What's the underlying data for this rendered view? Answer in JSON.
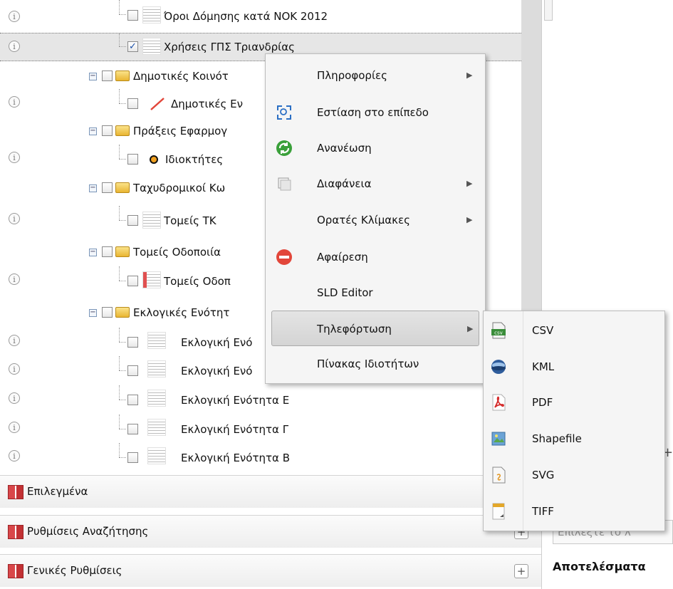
{
  "tree": {
    "info_glyph": "i",
    "rows": [
      {
        "label": "Όροι Δόμησης κατά ΝΟΚ 2012",
        "checked": false
      },
      {
        "label": "Χρήσεις ΓΠΣ Τριανδρίας",
        "checked": true
      },
      {
        "label": "Δημοτικές Κοινότ",
        "checked": false
      },
      {
        "label": "Δημοτικές Εν",
        "checked": false
      },
      {
        "label": "Πράξεις Εφαρμογ",
        "checked": false
      },
      {
        "label": "Ιδιοκτήτες",
        "checked": false
      },
      {
        "label": "Ταχυδρομικοί Κω",
        "checked": false
      },
      {
        "label": "Τομείς ΤΚ",
        "checked": false
      },
      {
        "label": "Τομείς Οδοποιία",
        "checked": false
      },
      {
        "label": "Τομείς Οδοπ",
        "checked": false
      },
      {
        "label": "Εκλογικές Ενότητ",
        "checked": false
      },
      {
        "label": "Εκλογική Ενό",
        "checked": false
      },
      {
        "label": "Εκλογική Ενό",
        "checked": false
      },
      {
        "label": "Εκλογική Ενότητα Ε",
        "checked": false
      },
      {
        "label": "Εκλογική Ενότητα Γ",
        "checked": false
      },
      {
        "label": "Εκλογική Ενότητα Β",
        "checked": false
      }
    ]
  },
  "accordion": {
    "selected_label": "Επιλεγμένα",
    "search_settings_label": "Ρυθμίσεις Αναζήτησης",
    "general_settings_label": "Γενικές Ρυθμίσεις",
    "plus": "+"
  },
  "context_menu": {
    "info": "Πληροφορίες",
    "zoom_to_layer": "Εστίαση στο επίπεδο",
    "refresh": "Ανανέωση",
    "opacity": "Διαφάνεια",
    "visible_scales": "Ορατές Κλίμακες",
    "remove": "Αφαίρεση",
    "sld_editor": "SLD Editor",
    "download": "Τηλεφόρτωση",
    "attribute_table": "Πίνακας Ιδιοτήτων",
    "arrow": "▶"
  },
  "download_submenu": {
    "csv": "CSV",
    "kml": "KML",
    "pdf": "PDF",
    "shapefile": "Shapefile",
    "svg": "SVG",
    "tiff": "TIFF"
  },
  "right_panel": {
    "search_placeholder": "Επιλέξτε το λ",
    "results_title": "Αποτελέσματα"
  },
  "icons": {
    "info": "info-icon",
    "zoom": "zoom-extent-icon",
    "refresh": "refresh-icon",
    "opacity": "opacity-icon",
    "remove": "remove-icon",
    "csv": "csv-file-icon",
    "kml": "kml-globe-icon",
    "pdf": "pdf-icon",
    "shapefile": "shapefile-icon",
    "svg": "svg-file-icon",
    "tiff": "tiff-file-icon"
  },
  "colors": {
    "remove_red": "#e2463a",
    "refresh_green": "#3aa03a",
    "accent_red": "#c23134",
    "selection": "#e6e6e6"
  }
}
